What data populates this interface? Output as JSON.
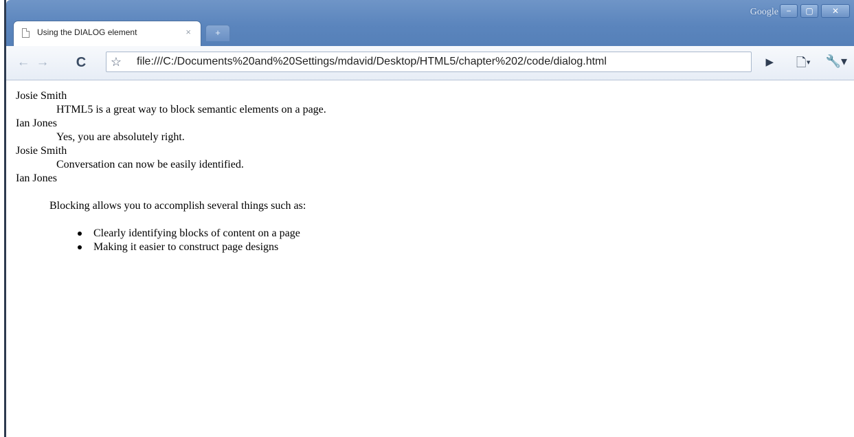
{
  "window": {
    "brand": "Google",
    "controls": {
      "minimize": "−",
      "maximize": "▢",
      "close": "✕"
    }
  },
  "tab": {
    "title": "Using the DIALOG element",
    "close_glyph": "×",
    "favicon": "page-icon"
  },
  "new_tab": {
    "glyph": "+"
  },
  "toolbar": {
    "back_glyph": "←",
    "forward_glyph": "→",
    "reload_glyph": "C",
    "star_glyph": "☆",
    "url": "file:///C:/Documents%20and%20Settings/mdavid/Desktop/HTML5/chapter%202/code/dialog.html",
    "go_glyph": "▶",
    "page_menu_glyph": "🗋▾",
    "tools_menu_glyph": "🔧▾"
  },
  "dialog": [
    {
      "speaker": "Josie Smith",
      "line": "HTML5 is a great way to block semantic elements on a page."
    },
    {
      "speaker": "Ian Jones",
      "line": "Yes, you are absolutely right."
    },
    {
      "speaker": "Josie Smith",
      "line": "Conversation can now be easily identified."
    },
    {
      "speaker": "Ian Jones",
      "paragraph": "Blocking allows you to accomplish several things such as:",
      "bullets": [
        "Clearly identifying blocks of content on a page",
        "Making it easier to construct page designs"
      ]
    }
  ]
}
